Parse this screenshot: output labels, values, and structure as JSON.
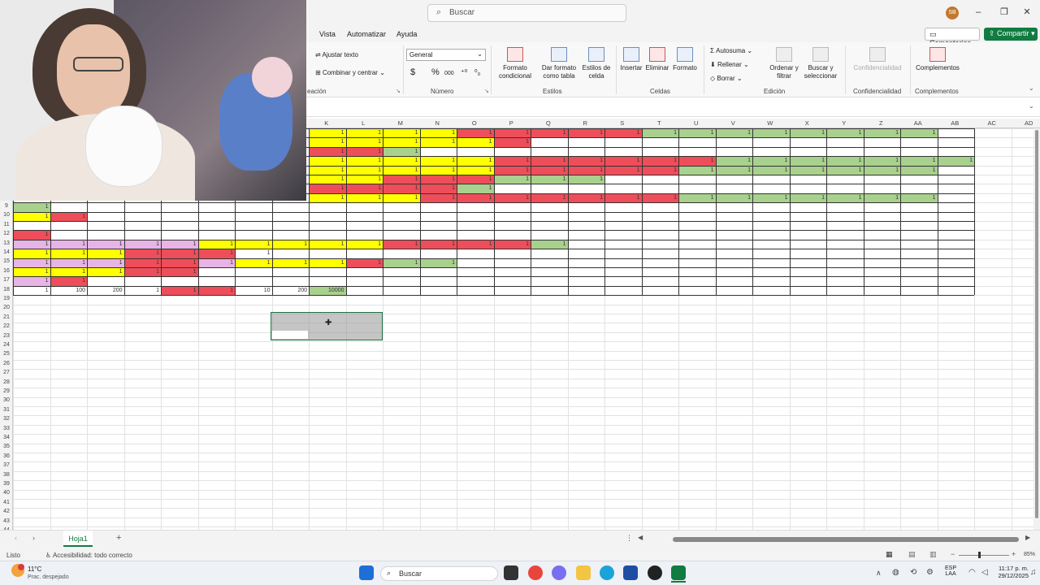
{
  "titlebar": {
    "search_placeholder": "Buscar",
    "avatar_initials": "SB"
  },
  "menu": {
    "items": [
      "Vista",
      "Automatizar",
      "Ayuda"
    ],
    "comments": "Comentarios",
    "share": "Compartir"
  },
  "ribbon": {
    "alineacion": {
      "wrap": "Ajustar texto",
      "merge": "Combinar y centrar",
      "label": "eación"
    },
    "numero": {
      "format": "General",
      "currency": "$",
      "percent": "%",
      "thousands": "000",
      "label": "Número"
    },
    "estilos": {
      "cond_format": [
        "Formato",
        "condicional"
      ],
      "table_format": [
        "Dar formato",
        "como tabla"
      ],
      "cell_styles": [
        "Estilos de",
        "celda"
      ],
      "label": "Estilos"
    },
    "celdas": {
      "insert": "Insertar",
      "delete": "Eliminar",
      "format": "Formato",
      "label": "Celdas"
    },
    "edicion": {
      "autosum": "Autosuma",
      "fill": "Rellenar",
      "clear": "Borrar",
      "sort": [
        "Ordenar y",
        "filtrar"
      ],
      "find": [
        "Buscar y",
        "seleccionar"
      ],
      "label": "Edición"
    },
    "confidencialidad": {
      "button": "Confidencialidad",
      "label": "Confidencialidad"
    },
    "complementos": {
      "button": "Complementos",
      "label": "Complementos"
    }
  },
  "grid": {
    "columns": [
      "K",
      "L",
      "M",
      "N",
      "O",
      "P",
      "Q",
      "R",
      "S",
      "T",
      "U",
      "V",
      "W",
      "X",
      "Y",
      "Z",
      "AA",
      "AB",
      "AC",
      "AD"
    ],
    "rows": [
      "9",
      "10",
      "11",
      "12",
      "13",
      "14",
      "15",
      "16",
      "17",
      "18",
      "19",
      "20",
      "21",
      "22",
      "23",
      "24",
      "25",
      "26",
      "27",
      "28",
      "29",
      "30",
      "31",
      "32",
      "33",
      "34",
      "35",
      "36",
      "37",
      "38",
      "39",
      "40",
      "41",
      "42",
      "43",
      "44"
    ],
    "colors": {
      "yellow": "#ffff00",
      "red": "#ee4e5a",
      "green": "#a9d18e",
      "pink": "#e8b4e6",
      "gray": "#d9d9d9"
    },
    "row18_values": [
      "1",
      "100",
      "200",
      "1",
      "1",
      "1",
      "10",
      "200",
      "10000"
    ]
  },
  "sheets": {
    "tabs": [
      "Hoja1"
    ]
  },
  "status": {
    "ready": "Listo",
    "accessibility": "Accesibilidad: todo correcto",
    "zoom": "85%"
  },
  "taskbar": {
    "weather_temp": "11°C",
    "weather_desc": "Prac. despejado",
    "search": "Buscar",
    "lang": [
      "ESP",
      "LAA"
    ],
    "time": "11:17 p. m.",
    "date": "29/12/2025"
  }
}
